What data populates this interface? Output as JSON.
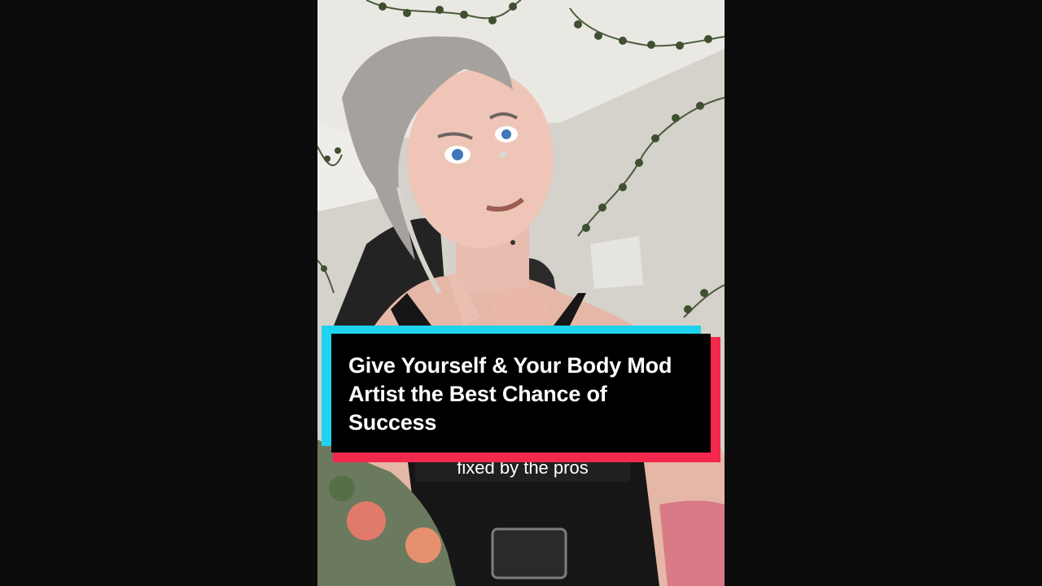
{
  "video": {
    "subtitle": "fixed by the pros",
    "title_card": {
      "text": "Give Yourself & Your Body Mod Artist the Best Chance of Success"
    }
  },
  "colors": {
    "background": "#0c0c0c",
    "card_cyan": "#1fd3ee",
    "card_pink": "#f2294d",
    "card_fill": "#000000"
  }
}
